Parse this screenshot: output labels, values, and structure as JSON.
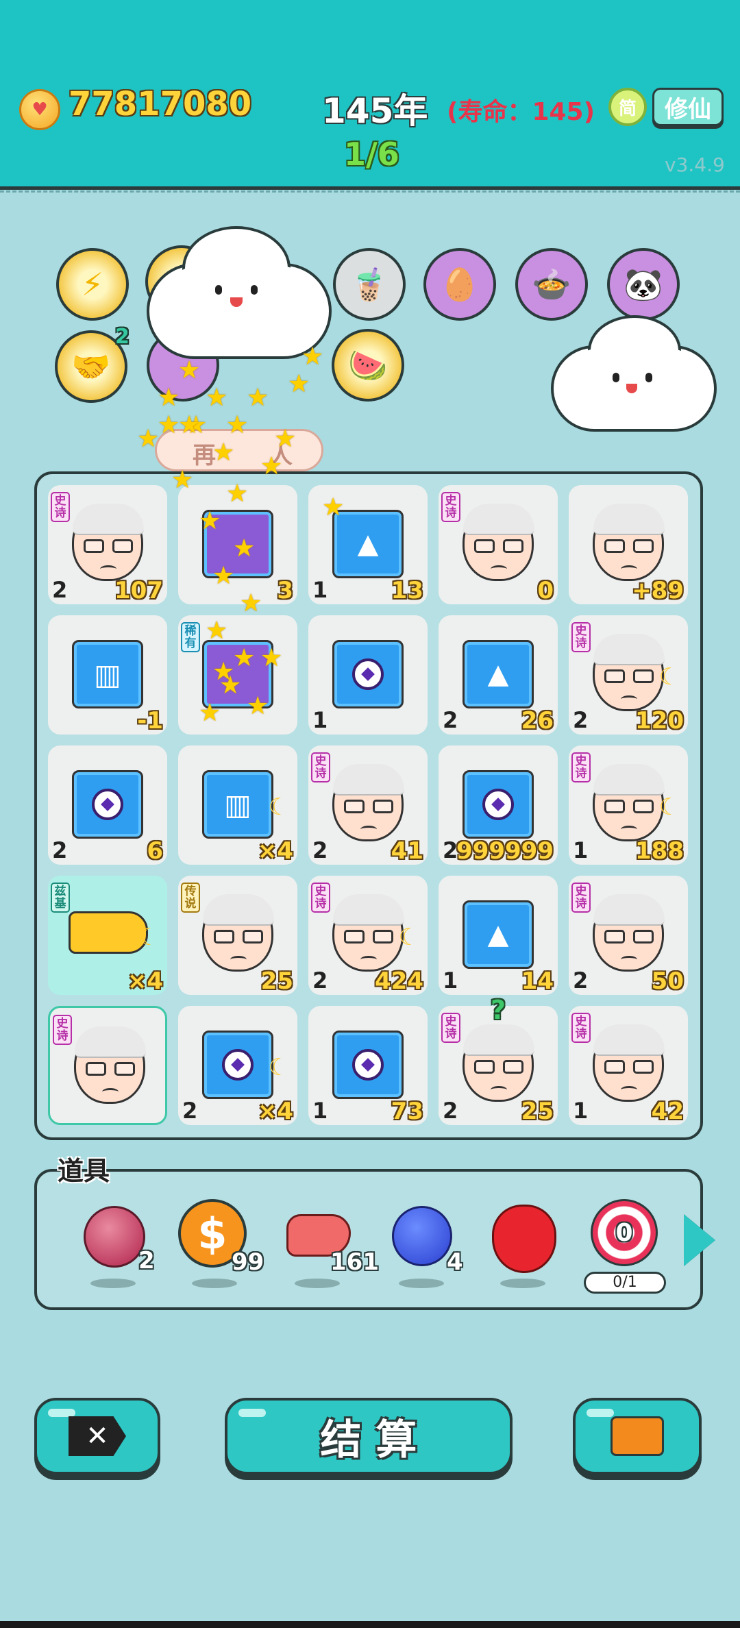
{
  "header": {
    "coins": "77817080",
    "year": "145年",
    "lifespan": "(寿命：145)",
    "progress": "1/6",
    "simp_label": "简",
    "xiuxian_label": "修仙",
    "version": "v3.4.9"
  },
  "powerups": {
    "handshake_count": "2",
    "banner_left": "再",
    "banner_right": "人"
  },
  "grid": {
    "cells": [
      {
        "tag": "史诗",
        "count": "2",
        "value": "107",
        "type": "elder"
      },
      {
        "tag": "",
        "count": "",
        "value": "3",
        "type": "card"
      },
      {
        "tag": "",
        "count": "1",
        "value": "13",
        "type": "gold"
      },
      {
        "tag": "史诗",
        "count": "",
        "value": "0",
        "type": "elder"
      },
      {
        "tag": "",
        "count": "",
        "value": "+89",
        "type": "elder"
      },
      {
        "tag": "",
        "count": "",
        "value": "-1",
        "type": "chart"
      },
      {
        "tag": "稀有",
        "count": "",
        "value": "",
        "type": "card"
      },
      {
        "tag": "",
        "count": "1",
        "value": "",
        "type": "stopwatch"
      },
      {
        "tag": "",
        "count": "2",
        "value": "26",
        "type": "gold"
      },
      {
        "tag": "史诗",
        "count": "2",
        "value": "120",
        "type": "elder"
      },
      {
        "tag": "",
        "count": "2",
        "value": "6",
        "type": "stopwatch"
      },
      {
        "tag": "",
        "count": "",
        "value": "×4",
        "type": "chart"
      },
      {
        "tag": "史诗",
        "count": "2",
        "value": "41",
        "type": "elder"
      },
      {
        "tag": "",
        "count": "2",
        "value": "999999",
        "type": "stopwatch"
      },
      {
        "tag": "史诗",
        "count": "1",
        "value": "188",
        "type": "elder"
      },
      {
        "tag": "兹基",
        "count": "",
        "value": "×4",
        "type": "hand"
      },
      {
        "tag": "传说",
        "count": "",
        "value": "25",
        "type": "elder"
      },
      {
        "tag": "史诗",
        "count": "2",
        "value": "424",
        "type": "elder"
      },
      {
        "tag": "",
        "count": "1",
        "value": "14",
        "type": "gold"
      },
      {
        "tag": "史诗",
        "count": "2",
        "value": "50",
        "type": "elder"
      },
      {
        "tag": "史诗",
        "count": "",
        "value": "",
        "type": "elder"
      },
      {
        "tag": "",
        "count": "2",
        "value": "×4",
        "type": "stopwatch"
      },
      {
        "tag": "",
        "count": "1",
        "value": "73",
        "type": "stopwatch"
      },
      {
        "tag": "史诗",
        "count": "2",
        "value": "25",
        "type": "elder"
      },
      {
        "tag": "史诗",
        "count": "1",
        "value": "42",
        "type": "elder"
      }
    ]
  },
  "question_mark": "?",
  "items": {
    "label": "道具",
    "lychee_count": "2",
    "coin_count": "99",
    "liver_count": "161",
    "blueberry_count": "4",
    "target_value": "0",
    "target_progress": "0/1"
  },
  "bottom": {
    "settle_label": "结 算"
  }
}
